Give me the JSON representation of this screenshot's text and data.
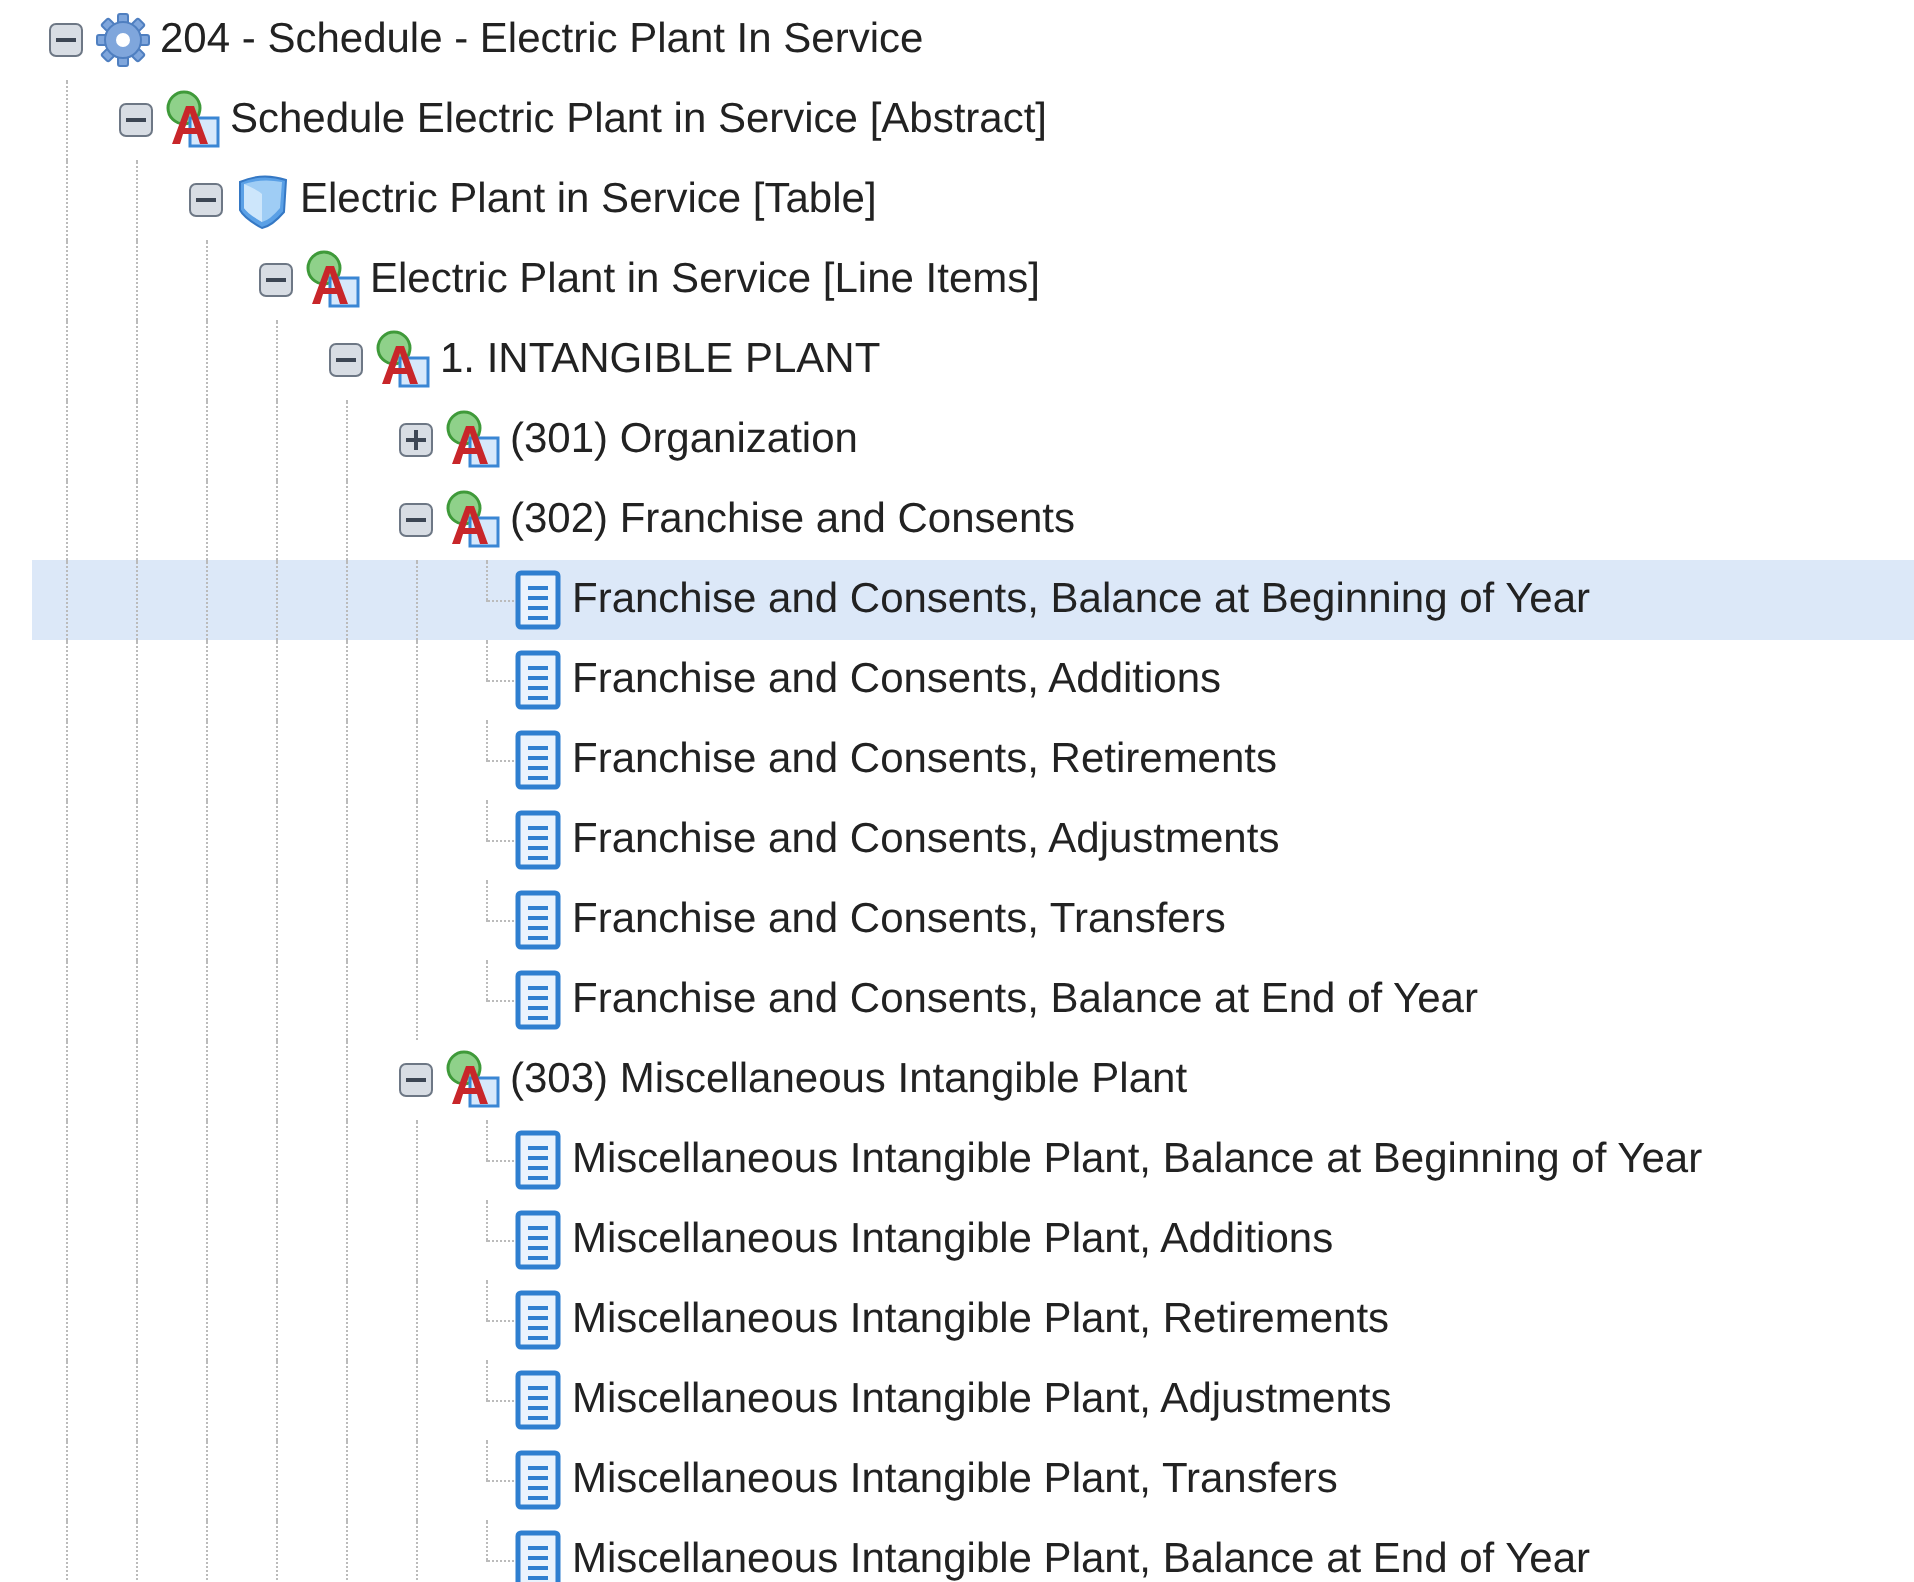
{
  "tree": [
    {
      "kind": "schedule",
      "label": "204 - Schedule - Electric Plant In Service",
      "expanded": true,
      "selected": false,
      "children": [
        {
          "kind": "abstract",
          "label": "Schedule Electric Plant in Service [Abstract]",
          "expanded": true,
          "selected": false,
          "children": [
            {
              "kind": "table",
              "label": "Electric Plant in Service [Table]",
              "expanded": true,
              "selected": false,
              "children": [
                {
                  "kind": "abstract",
                  "label": "Electric Plant in Service [Line Items]",
                  "expanded": true,
                  "selected": false,
                  "children": [
                    {
                      "kind": "abstract",
                      "label": "1. INTANGIBLE PLANT",
                      "expanded": true,
                      "selected": false,
                      "children": [
                        {
                          "kind": "abstract",
                          "label": "(301) Organization",
                          "expanded": false,
                          "selected": false
                        },
                        {
                          "kind": "abstract",
                          "label": "(302) Franchise and Consents",
                          "expanded": true,
                          "selected": false,
                          "children": [
                            {
                              "kind": "element",
                              "label": "Franchise and Consents, Balance at Beginning of Year",
                              "selected": true
                            },
                            {
                              "kind": "element",
                              "label": "Franchise and Consents, Additions",
                              "selected": false
                            },
                            {
                              "kind": "element",
                              "label": "Franchise and Consents, Retirements",
                              "selected": false
                            },
                            {
                              "kind": "element",
                              "label": "Franchise and Consents, Adjustments",
                              "selected": false
                            },
                            {
                              "kind": "element",
                              "label": "Franchise and Consents, Transfers",
                              "selected": false
                            },
                            {
                              "kind": "element",
                              "label": "Franchise and Consents, Balance at End of Year",
                              "selected": false
                            }
                          ]
                        },
                        {
                          "kind": "abstract",
                          "label": "(303) Miscellaneous Intangible Plant",
                          "expanded": true,
                          "selected": false,
                          "children": [
                            {
                              "kind": "element",
                              "label": "Miscellaneous Intangible Plant, Balance at Beginning of Year",
                              "selected": false
                            },
                            {
                              "kind": "element",
                              "label": "Miscellaneous Intangible Plant, Additions",
                              "selected": false
                            },
                            {
                              "kind": "element",
                              "label": "Miscellaneous Intangible Plant, Retirements",
                              "selected": false
                            },
                            {
                              "kind": "element",
                              "label": "Miscellaneous Intangible Plant, Adjustments",
                              "selected": false
                            },
                            {
                              "kind": "element",
                              "label": "Miscellaneous Intangible Plant, Transfers",
                              "selected": false
                            },
                            {
                              "kind": "element",
                              "label": "Miscellaneous Intangible Plant, Balance at End of Year",
                              "selected": false
                            }
                          ]
                        }
                      ]
                    }
                  ]
                }
              ]
            }
          ]
        }
      ]
    }
  ]
}
